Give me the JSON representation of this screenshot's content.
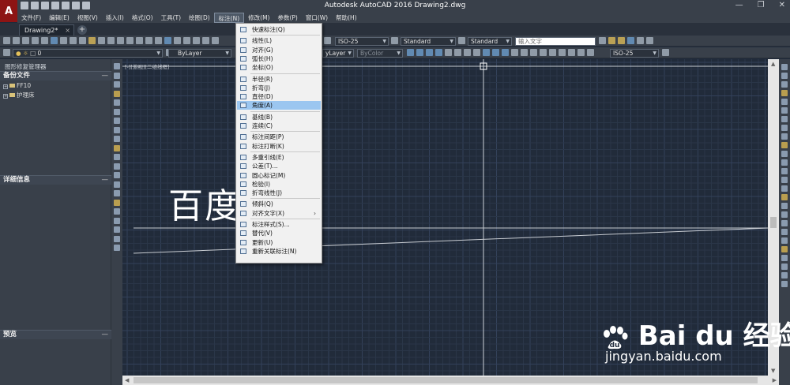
{
  "app": {
    "logo_letter": "A",
    "title": "Autodesk AutoCAD 2016    Drawing2.dwg"
  },
  "menubar": {
    "items": [
      "文件(F)",
      "编辑(E)",
      "视图(V)",
      "插入(I)",
      "格式(O)",
      "工具(T)",
      "绘图(D)",
      "标注(N)",
      "修改(M)",
      "参数(P)",
      "窗口(W)",
      "帮助(H)"
    ],
    "active_index": 7
  },
  "tabs": {
    "document": "Drawing2*",
    "new_tab_symbol": "+"
  },
  "toolbar1": {
    "dim_style": "ISO-25",
    "text_style": "Standard",
    "table_style": "Standard",
    "search_placeholder": "输入文字"
  },
  "toolbar2": {
    "layer_value": "0",
    "color_value": "ByLayer",
    "linetype_value": "yLayer",
    "lineweight_value": "ByColor",
    "dim_style": "ISO-25"
  },
  "left_panel": {
    "title": "图形修复管理器",
    "sections": {
      "backup": "备份文件",
      "details": "详细信息",
      "preview": "预览"
    },
    "tree": [
      "FF10",
      "护理床"
    ]
  },
  "canvas": {
    "view_label": "[-][俯视][二维线框]",
    "big_text": "百度经验",
    "grid_color": "#2a3648",
    "grid_major_color": "#33415a",
    "line_color": "#c8ccd2"
  },
  "dim_menu": {
    "items": [
      {
        "label": "快速标注(Q)",
        "sep_after": true
      },
      {
        "label": "线性(L)"
      },
      {
        "label": "对齐(G)"
      },
      {
        "label": "弧长(H)"
      },
      {
        "label": "坐标(O)",
        "sep_after": true
      },
      {
        "label": "半径(R)"
      },
      {
        "label": "折弯(J)"
      },
      {
        "label": "直径(D)"
      },
      {
        "label": "角度(A)",
        "highlight": true,
        "sep_after": true
      },
      {
        "label": "基线(B)"
      },
      {
        "label": "连续(C)",
        "sep_after": true
      },
      {
        "label": "标注间距(P)"
      },
      {
        "label": "标注打断(K)",
        "sep_after": true
      },
      {
        "label": "多重引线(E)"
      },
      {
        "label": "公差(T)..."
      },
      {
        "label": "圆心标记(M)"
      },
      {
        "label": "检验(I)"
      },
      {
        "label": "折弯线性(J)",
        "sep_after": true
      },
      {
        "label": "倾斜(Q)"
      },
      {
        "label": "对齐文字(X)",
        "submenu": true,
        "sep_after": true
      },
      {
        "label": "标注样式(S)..."
      },
      {
        "label": "替代(V)"
      },
      {
        "label": "更新(U)"
      },
      {
        "label": "重新关联标注(N)"
      }
    ]
  },
  "watermark": {
    "logo": "Bai du 经验",
    "url": "jingyan.baidu.com"
  }
}
